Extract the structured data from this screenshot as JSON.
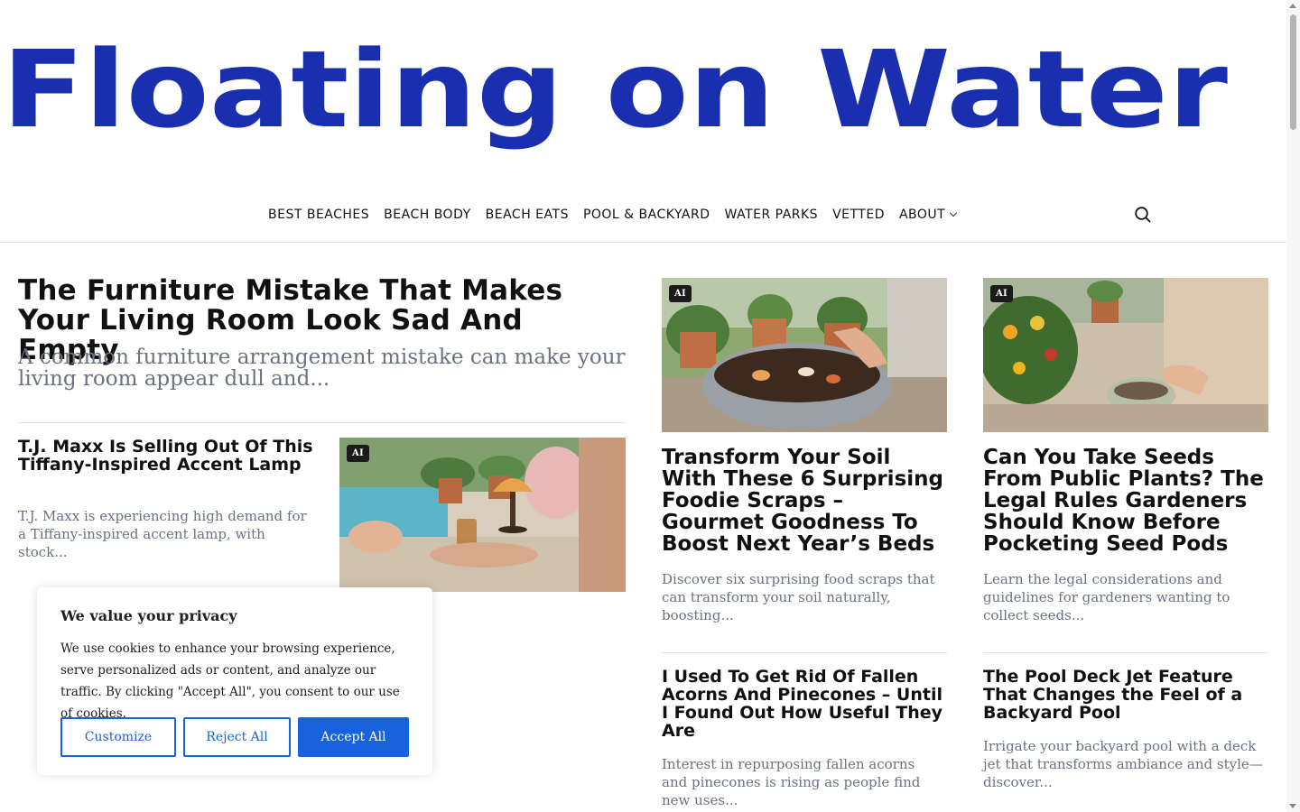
{
  "site": {
    "logo_text": "Floating on Water",
    "brand_color": "#1a2fb0"
  },
  "nav": {
    "items": [
      "BEST BEACHES",
      "BEACH BODY",
      "BEACH EATS",
      "POOL & BACKYARD",
      "WATER PARKS",
      "VETTED",
      "ABOUT"
    ],
    "search_icon": "search-icon"
  },
  "hero": {
    "title": "The Furniture Mistake That Makes Your Living Room Look Sad And Empty",
    "excerpt": "A common furniture arrangement mistake can make your living room appear dull and..."
  },
  "articles": {
    "tj": {
      "title": "T.J. Maxx Is Selling Out Of This Tiffany-Inspired Accent Lamp",
      "excerpt": "T.J. Maxx is experiencing high demand for a Tiffany-inspired accent lamp, with stock...",
      "badge": "AI"
    },
    "soil": {
      "title": "Transform Your Soil With These 6 Surprising Foodie Scraps – Gourmet Goodness To Boost Next Year’s Beds",
      "excerpt": "Discover six surprising food scraps that can transform your soil naturally, boosting...",
      "badge": "AI"
    },
    "seeds": {
      "title": "Can You Take Seeds From Public Plants? The Legal Rules Gardeners Should Know Before Pocketing Seed Pods",
      "excerpt": "Learn the legal considerations and guidelines for gardeners wanting to collect seeds...",
      "badge": "AI"
    },
    "acorns": {
      "title": "I Used To Get Rid Of Fallen Acorns And Pinecones – Until I Found Out How Useful They Are",
      "excerpt": "Interest in repurposing fallen acorns and pinecones is rising as people find new uses..."
    },
    "pool": {
      "title": "The Pool Deck Jet Feature That Changes the Feel of a Backyard Pool",
      "excerpt": "Irrigate your backyard pool with a deck jet that transforms ambiance and style—discover..."
    }
  },
  "cookie": {
    "title": "We value your privacy",
    "body": "We use cookies to enhance your browsing experience, serve personalized ads or content, and analyze our traffic. By clicking \"Accept All\", you consent to our use of cookies.",
    "customize": "Customize",
    "reject": "Reject All",
    "accept": "Accept All",
    "accent_color": "#1863dc"
  }
}
